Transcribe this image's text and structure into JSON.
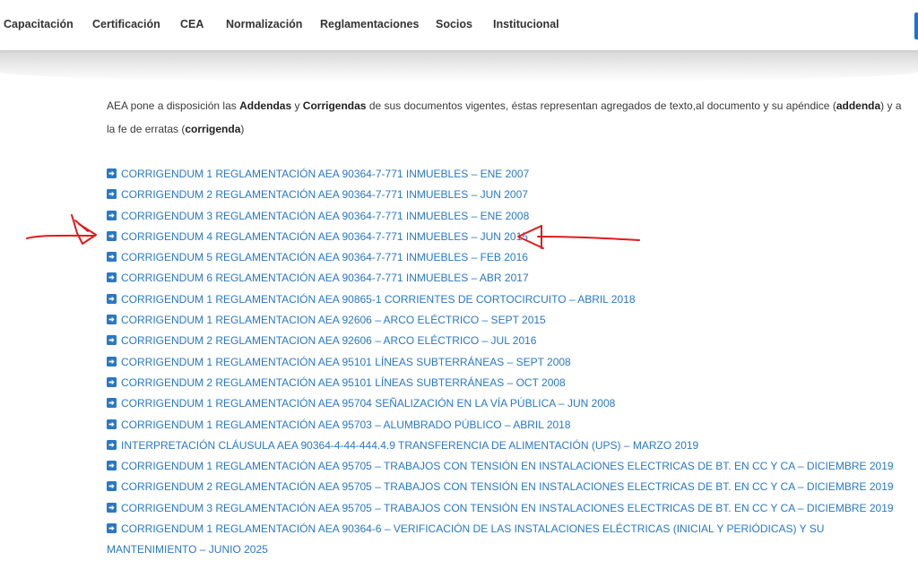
{
  "nav": {
    "items": [
      "Capacitación",
      "Certificación",
      "CEA",
      "Normalización",
      "Reglamentaciones",
      "Socios",
      "Institucional"
    ]
  },
  "intro": {
    "t1": "AEA pone a disposición las ",
    "b1": "Addendas",
    "t2": " y ",
    "b2": "Corrigendas",
    "t3": " de sus documentos vigentes, éstas representan agregados de texto,al documento y su apéndice (",
    "b3": "addenda",
    "t4": ") y a la fe de erratas (",
    "b4": "corrigenda",
    "t5": ")"
  },
  "documents": [
    "CORRIGENDUM 1 REGLAMENTACIÓN AEA 90364-7-771 INMUEBLES – ENE 2007",
    "CORRIGENDUM 2 REGLAMENTACIÓN AEA 90364-7-771 INMUEBLES – JUN 2007",
    "CORRIGENDUM 3 REGLAMENTACIÓN AEA 90364-7-771 INMUEBLES – ENE 2008",
    "CORRIGENDUM 4 REGLAMENTACIÓN AEA 90364-7-771 INMUEBLES – JUN 2015",
    "CORRIGENDUM 5 REGLAMENTACIÓN AEA 90364-7-771 INMUEBLES – FEB 2016",
    "CORRIGENDUM 6 REGLAMENTACIÓN AEA 90364-7-771 INMUEBLES – ABR 2017",
    "CORRIGENDUM 1 REGLAMENTACIÓN AEA 90865-1  CORRIENTES DE CORTOCIRCUITO – ABRIL 2018",
    "CORRIGENDUM 1 REGLAMENTACION AEA 92606 – ARCO ELÉCTRICO – SEPT 2015",
    "CORRIGENDUM 2 REGLAMENTACION AEA 92606 – ARCO ELÉCTRICO – JUL 2016",
    "CORRIGENDUM 1 REGLAMENTACIÓN AEA 95101 LÍNEAS SUBTERRÁNEAS – SEPT 2008",
    "CORRIGENDUM 2 REGLAMENTACIÓN AEA 95101 LÍNEAS SUBTERRÁNEAS – OCT 2008",
    "CORRIGENDUM 1 REGLAMENTACIÓN AEA 95704 SEÑALIZACIÓN EN LA VÍA PÚBLICA – JUN 2008",
    "CORRIGENDUM 1 REGLAMENTACIÓN AEA 95703 – ALUMBRADO PÚBLICO – ABRIL 2018",
    "INTERPRETACIÓN CLÁUSULA AEA 90364-4-44-444.4.9 TRANSFERENCIA DE ALIMENTACIÓN (UPS) – MARZO 2019",
    "CORRIGENDUM 1 REGLAMENTACIÓN AEA 95705 – TRABAJOS CON TENSIÓN EN INSTALACIONES ELECTRICAS DE BT. EN CC Y CA – DICIEMBRE 2019",
    "CORRIGENDUM 2 REGLAMENTACIÓN AEA 95705 – TRABAJOS CON TENSIÓN EN INSTALACIONES ELECTRICAS DE BT. EN CC Y CA – DICIEMBRE 2019",
    "CORRIGENDUM 3 REGLAMENTACIÓN AEA 95705 – TRABAJOS CON TENSIÓN EN INSTALACIONES ELECTRICAS DE BT. EN CC Y CA – DICIEMBRE 2019",
    "CORRIGENDUM 1 REGLAMENTACIÓN AEA 90364-6 – VERIFICACIÓN DE LAS INSTALACIONES ELÉCTRICAS (INICIAL Y PERIÓDICAS) Y SU MANTENIMIENTO – JUNIO 2025"
  ],
  "colors": {
    "link": "#2a78c4",
    "annotation": "#e01b1b"
  },
  "icons": {
    "list_bullet": "arrow-right-square-icon"
  }
}
